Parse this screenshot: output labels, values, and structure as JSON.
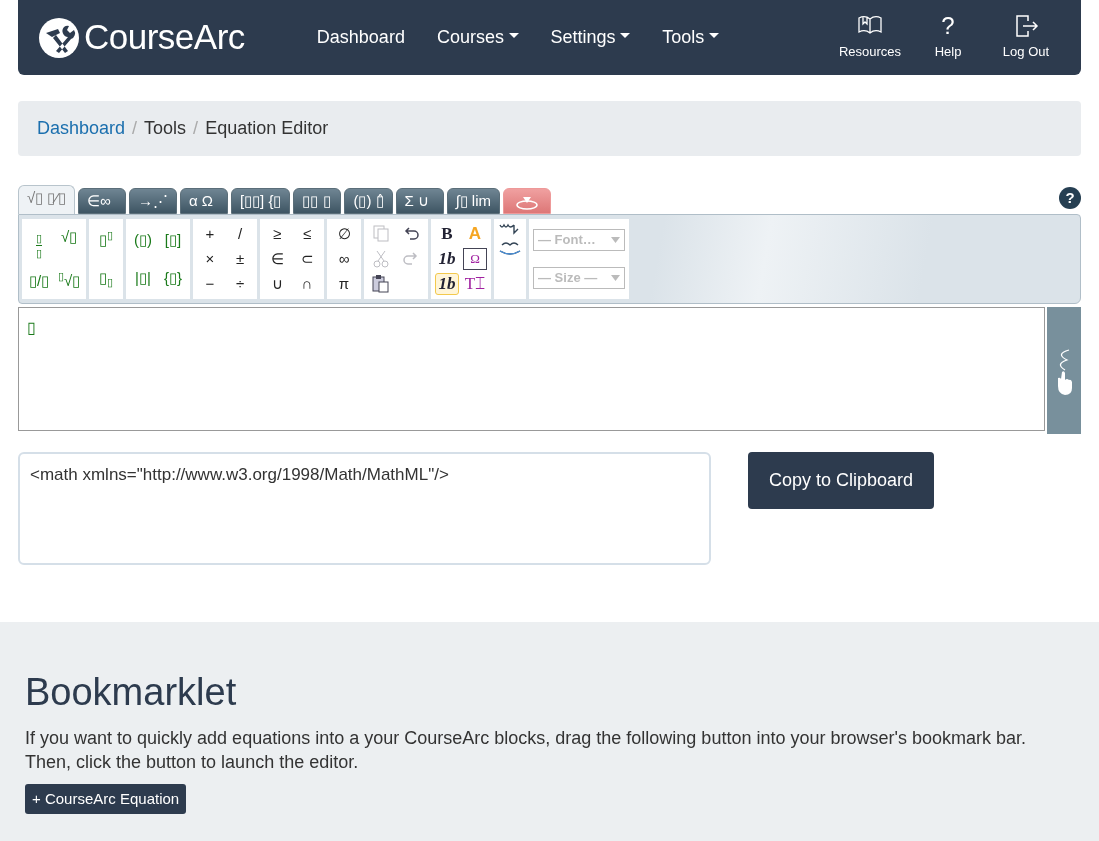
{
  "navbar": {
    "brand": "**Course**Arc",
    "links": [
      {
        "label": "Dashboard",
        "dropdown": false
      },
      {
        "label": "Courses",
        "dropdown": true
      },
      {
        "label": "Settings",
        "dropdown": true
      },
      {
        "label": "Tools",
        "dropdown": true
      }
    ],
    "actions": [
      {
        "label": "Resources",
        "kind": "book"
      },
      {
        "label": "Help",
        "kind": "help",
        "symbol": "?"
      },
      {
        "label": "Log Out",
        "kind": "logout"
      }
    ]
  },
  "breadcrumb": [
    {
      "label": "Dashboard",
      "link": true
    },
    {
      "separator": "/",
      "label": "Tools",
      "link": false
    },
    {
      "separator": "/",
      "label": "Equation Editor",
      "link": false
    }
  ],
  "editor": {
    "tabs": [
      {
        "label": "√▯ ▯⁄▯",
        "selected": true,
        "kind": "text"
      },
      {
        "label": "∈∞",
        "selected": false,
        "kind": "text"
      },
      {
        "label": "→⋰",
        "selected": false,
        "kind": "text"
      },
      {
        "label": "α Ω",
        "selected": false,
        "kind": "text"
      },
      {
        "label": "[▯▯] {▯",
        "selected": false,
        "kind": "text"
      },
      {
        "label": "▯▯ ▯",
        "selected": false,
        "kind": "text"
      },
      {
        "label": "(▯) ▯̂",
        "selected": false,
        "kind": "text"
      },
      {
        "label": "Σ ∪",
        "selected": false,
        "kind": "text"
      },
      {
        "label": "∫▯ lim",
        "selected": false,
        "kind": "text"
      },
      {
        "selected": false,
        "kind": "handwriting"
      }
    ],
    "palette": [
      {
        "rows": [
          [
            {
              "kind": "fraction",
              "top": "▯",
              "bottom": "▯"
            },
            {
              "kind": "text",
              "text": "√▯",
              "template": true
            }
          ],
          [
            {
              "kind": "text",
              "text": "▯/▯",
              "template": true
            },
            {
              "kind": "nroot",
              "index": "▯",
              "body": "√▯"
            }
          ]
        ]
      },
      {
        "rows": [
          [
            {
              "kind": "sup",
              "base": "▯",
              "script": "▯"
            }
          ],
          [
            {
              "kind": "sub",
              "base": "▯",
              "script": "▯"
            }
          ]
        ]
      },
      {
        "rows": [
          [
            {
              "kind": "text",
              "text": "(▯)",
              "template": true
            },
            {
              "kind": "text",
              "text": "[▯]",
              "template": true
            }
          ],
          [
            {
              "kind": "text",
              "text": "|▯|",
              "template": true
            },
            {
              "kind": "text",
              "text": "{▯}",
              "template": true
            }
          ]
        ]
      },
      {
        "rows": [
          [
            {
              "kind": "text",
              "text": "+",
              "template": false
            },
            {
              "kind": "text",
              "text": "/",
              "template": false
            }
          ],
          [
            {
              "kind": "text",
              "text": "×",
              "template": false
            },
            {
              "kind": "text",
              "text": "±",
              "template": false
            }
          ],
          [
            {
              "kind": "text",
              "text": "−",
              "template": false
            },
            {
              "kind": "text",
              "text": "÷",
              "template": false
            }
          ]
        ]
      },
      {
        "rows": [
          [
            {
              "kind": "text",
              "text": "≥",
              "template": false
            },
            {
              "kind": "text",
              "text": "≤",
              "template": false
            }
          ],
          [
            {
              "kind": "text",
              "text": "∈",
              "template": false
            },
            {
              "kind": "text",
              "text": "⊂",
              "template": false
            }
          ],
          [
            {
              "kind": "text",
              "text": "∪",
              "template": false
            },
            {
              "kind": "text",
              "text": "∩",
              "template": false
            }
          ]
        ]
      },
      {
        "rows": [
          [
            {
              "kind": "text",
              "text": "∅",
              "template": false
            }
          ],
          [
            {
              "kind": "text",
              "text": "∞",
              "template": false
            }
          ],
          [
            {
              "kind": "text",
              "text": "π",
              "template": false
            }
          ]
        ]
      }
    ],
    "edit_tools": [
      [
        {
          "kind": "copy",
          "disabled": true
        },
        {
          "kind": "undo",
          "disabled": false
        }
      ],
      [
        {
          "kind": "cut",
          "disabled": true
        },
        {
          "kind": "redo",
          "disabled": true
        }
      ],
      [
        {
          "kind": "paste",
          "disabled": false
        }
      ]
    ],
    "format_tools": [
      [
        {
          "kind": "bold",
          "label": "B",
          "selected": false
        },
        {
          "kind": "color",
          "label": "A",
          "selected": false
        }
      ],
      [
        {
          "kind": "italic",
          "label": "1b",
          "selected": false
        },
        {
          "kind": "boxed",
          "label": "Ω",
          "selected": false
        }
      ],
      [
        {
          "kind": "italic",
          "label": "1b",
          "selected": true
        },
        {
          "kind": "textmode",
          "label": "T⌶",
          "selected": false
        }
      ]
    ],
    "direction_tools": [
      {
        "kind": "rtl"
      },
      {
        "kind": "ltr"
      }
    ],
    "font_select": "— Font…",
    "size_select": "— Size —",
    "cursor": "▯",
    "help_symbol": "?"
  },
  "output": {
    "value": "<math xmlns=\"http://www.w3.org/1998/Math/MathML\"/>",
    "copy_button": "Copy to Clipboard"
  },
  "bookmarklet": {
    "title": "Bookmarklet",
    "text": "If you want to quickly add equations into a your CourseArc blocks, drag the following button into your browser's bookmark bar. Then, click the button to launch the editor.",
    "button": "+ CourseArc Equation"
  }
}
